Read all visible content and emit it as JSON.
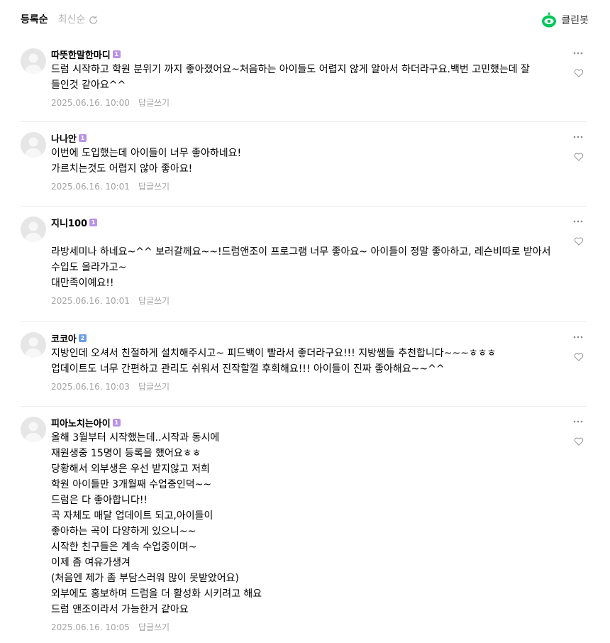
{
  "sort": {
    "registered_label": "등록순",
    "latest_label": "최신순"
  },
  "cleanbot": {
    "label": "클린봇",
    "icon": "cleanbot-icon",
    "color": "#03c75a"
  },
  "reply_label": "답글쓰기",
  "comments": [
    {
      "nickname": "따뜻한말한마디",
      "level": "1",
      "text": "드럼 시작하고 학원 분위기 까지 좋아졌어요~처음하는 아이들도 어렵지 않게 알아서 하더라구요.백번 고민했는데 잘 들인것 같아요^^",
      "date": "2025.06.16. 10:00"
    },
    {
      "nickname": "나나안",
      "level": "1",
      "text": "이번에 도입했는데 아이들이 너무 좋아하네요!\n가르치는것도 어렵지 않아 좋아요!",
      "date": "2025.06.16. 10:01"
    },
    {
      "nickname": "지니100",
      "level": "1",
      "text": "라방세미나 하네요~^^ 보러갈께요~~!드럼앤조이 프로그램 너무 좋아요~ 아이들이 정말 좋아하고, 레슨비따로 받아서 수입도 올라가고~\n대만족이예요!!",
      "date": "2025.06.16. 10:01"
    },
    {
      "nickname": "코코아",
      "level": "2",
      "text": "지방인데 오셔서 친절하게 설치해주시고~ 피드백이 빨라서 좋더라구요!!! 지방쌤들 추천합니다~~~ㅎㅎㅎ\n업데이트도 너무 간편하고 관리도 쉬워서 진작할껄 후회해요!!! 아이들이 진짜 좋아해요~~^^",
      "date": "2025.06.16. 10:03"
    },
    {
      "nickname": "피아노치는아이",
      "level": "1",
      "text": "올해 3월부터 시작했는데..시작과 동시에\n재원생중 15명이 등록을 했어요ㅎㅎ\n당황해서 외부생은 우선 받지않고 저희\n학원 아이들만 3개월째 수업중인덕~~\n드럼은 다 좋아합니다!!\n곡 자체도 매달 업데이트 되고,아이들이\n좋아하는 곡이 다양하게 있으니~~\n시작한 친구들은 계속 수업중이며~\n이제 좀 여유가생겨\n(처음엔 제가 좀 부담스러워 많이 못받았어요)\n외부에도 홍보하며 드럼을 더 활성화 시키려고 해요\n드럼 앤조이라서 가능한거 같아요",
      "date": "2025.06.16. 10:05"
    }
  ]
}
